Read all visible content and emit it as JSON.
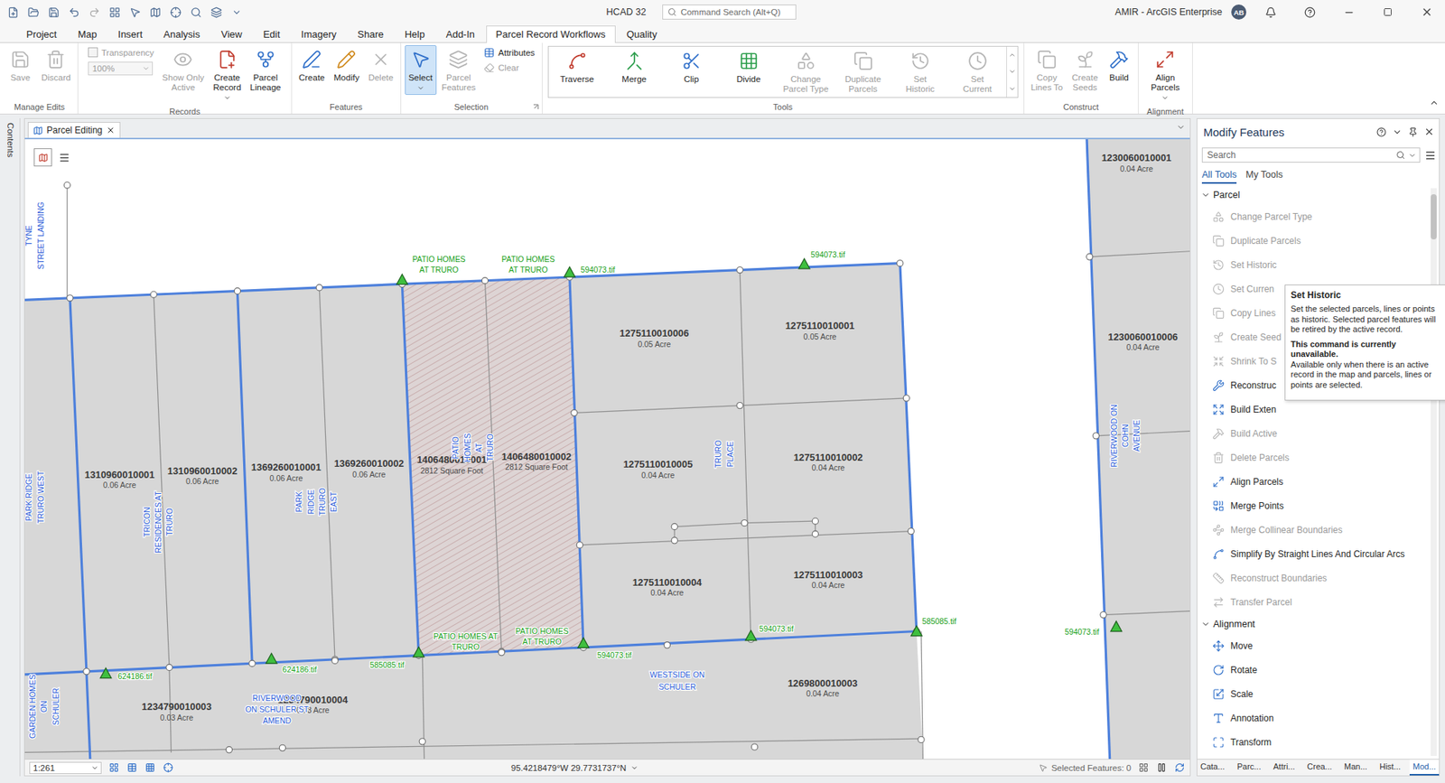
{
  "window": {
    "title": "HCAD 32",
    "account": "AMIR - ArcGIS Enterprise",
    "avatar": "AB"
  },
  "command_search": {
    "placeholder": "Command Search (Alt+Q)"
  },
  "ribbon_tabs": [
    {
      "label": "Project",
      "selected": false
    },
    {
      "label": "Map",
      "selected": false
    },
    {
      "label": "Insert",
      "selected": false
    },
    {
      "label": "Analysis",
      "selected": false
    },
    {
      "label": "View",
      "selected": false
    },
    {
      "label": "Edit",
      "selected": false
    },
    {
      "label": "Imagery",
      "selected": false
    },
    {
      "label": "Share",
      "selected": false
    },
    {
      "label": "Help",
      "selected": false
    },
    {
      "label": "Add-In",
      "selected": false
    },
    {
      "label": "Parcel Record Workflows",
      "selected": true
    },
    {
      "label": "Quality",
      "selected": false
    }
  ],
  "ribbon_groups": [
    {
      "label": "Manage Edits",
      "kind": "plain",
      "launcher": false,
      "items": [
        {
          "label": "Save",
          "kind": "large",
          "disabled": true,
          "selected": false,
          "dropdown": false
        },
        {
          "label": "Discard",
          "kind": "large",
          "disabled": true,
          "selected": false,
          "dropdown": false
        }
      ]
    },
    {
      "label": "Records",
      "kind": "plain",
      "launcher": false,
      "items": [
        {
          "label": "Transparency",
          "kind": "check",
          "disabled": true,
          "checked": false
        },
        {
          "label": "100%",
          "kind": "combo",
          "disabled": true
        },
        {
          "label": "Show Only\nActive",
          "kind": "large",
          "disabled": true,
          "selected": false,
          "dropdown": false
        },
        {
          "label": "Create\nRecord",
          "kind": "large",
          "disabled": false,
          "selected": false,
          "dropdown": true
        },
        {
          "label": "Parcel\nLineage",
          "kind": "large",
          "disabled": false,
          "selected": false,
          "dropdown": false
        }
      ]
    },
    {
      "label": "Features",
      "kind": "plain",
      "launcher": false,
      "items": [
        {
          "label": "Create",
          "kind": "large",
          "disabled": false,
          "selected": false,
          "dropdown": false
        },
        {
          "label": "Modify",
          "kind": "large",
          "disabled": false,
          "selected": false,
          "dropdown": false
        },
        {
          "label": "Delete",
          "kind": "large",
          "disabled": true,
          "selected": false,
          "dropdown": false
        }
      ]
    },
    {
      "label": "Selection",
      "kind": "plain",
      "launcher": true,
      "items": [
        {
          "label": "Select",
          "kind": "large",
          "disabled": false,
          "selected": true,
          "dropdown": true
        },
        {
          "label": "Parcel\nFeatures",
          "kind": "large",
          "disabled": true,
          "selected": false,
          "dropdown": false
        },
        {
          "label": "Attributes",
          "kind": "small",
          "disabled": false
        },
        {
          "label": "Clear",
          "kind": "small",
          "disabled": true
        }
      ]
    },
    {
      "label": "Tools",
      "kind": "gallery",
      "launcher": false,
      "items": [
        {
          "label": "Traverse",
          "kind": "large",
          "disabled": false,
          "selected": false,
          "dropdown": false
        },
        {
          "label": "Merge",
          "kind": "large",
          "disabled": false,
          "selected": false,
          "dropdown": false
        },
        {
          "label": "Clip",
          "kind": "large",
          "disabled": false,
          "selected": false,
          "dropdown": false
        },
        {
          "label": "Divide",
          "kind": "large",
          "disabled": false,
          "selected": false,
          "dropdown": false
        },
        {
          "label": "Change\nParcel Type",
          "kind": "large",
          "disabled": true,
          "selected": false,
          "dropdown": false
        },
        {
          "label": "Duplicate\nParcels",
          "kind": "large",
          "disabled": true,
          "selected": false,
          "dropdown": false
        },
        {
          "label": "Set\nHistoric",
          "kind": "large",
          "disabled": true,
          "selected": false,
          "dropdown": false
        },
        {
          "label": "Set\nCurrent",
          "kind": "large",
          "disabled": true,
          "selected": false,
          "dropdown": false
        }
      ]
    },
    {
      "label": "Construct",
      "kind": "plain",
      "launcher": false,
      "items": [
        {
          "label": "Copy\nLines To",
          "kind": "large",
          "disabled": true,
          "selected": false,
          "dropdown": false
        },
        {
          "label": "Create\nSeeds",
          "kind": "large",
          "disabled": true,
          "selected": false,
          "dropdown": false
        },
        {
          "label": "Build",
          "kind": "large",
          "disabled": false,
          "selected": false,
          "dropdown": false
        }
      ]
    },
    {
      "label": "Alignment",
      "kind": "plain",
      "launcher": false,
      "items": [
        {
          "label": "Align\nParcels",
          "kind": "large",
          "disabled": false,
          "selected": false,
          "dropdown": true
        }
      ]
    }
  ],
  "contents_pane": {
    "label": "Contents"
  },
  "map_view": {
    "tab": "Parcel Editing",
    "scale": "1:261",
    "coordinates": "95.4218479°W 29.7731737°N",
    "selected_features": "Selected Features: 0"
  },
  "map": {
    "parcels": [
      {
        "id": "1310960010001",
        "area": "0.06 Acre",
        "highlighted": false
      },
      {
        "id": "1310960010002",
        "area": "0.06 Acre",
        "highlighted": false
      },
      {
        "id": "1369260010001",
        "area": "0.06 Acre",
        "highlighted": false
      },
      {
        "id": "1369260010002",
        "area": "0.06 Acre",
        "highlighted": false
      },
      {
        "id": "1406480010001",
        "area": "2812 Square Foot",
        "highlighted": true
      },
      {
        "id": "1406480010002",
        "area": "2812 Square Foot",
        "highlighted": true
      },
      {
        "id": "1275110010006",
        "area": "0.05 Acre",
        "highlighted": false
      },
      {
        "id": "1275110010001",
        "area": "0.05 Acre",
        "highlighted": false
      },
      {
        "id": "1275110010005",
        "area": "0.04 Acre",
        "highlighted": false
      },
      {
        "id": "1275110010002",
        "area": "0.04 Acre",
        "highlighted": false
      },
      {
        "id": "1275110010004",
        "area": "0.04 Acre",
        "highlighted": false
      },
      {
        "id": "1275110010003",
        "area": "0.04 Acre",
        "highlighted": false
      },
      {
        "id": "1230060010001",
        "area": "0.04 Acre",
        "highlighted": false
      },
      {
        "id": "1230060010006",
        "area": "0.04 Acre",
        "highlighted": false
      },
      {
        "id": "1234790010003",
        "area": "0.03 Acre",
        "highlighted": false
      },
      {
        "id": "1234790010004",
        "area": "0.03 Acre",
        "highlighted": false
      },
      {
        "id": "1269800010003",
        "area": "0.04 Acre",
        "highlighted": false
      }
    ],
    "subdivisions": [
      {
        "lines": [
          "TYNE",
          "STREET LANDING"
        ],
        "kind": "vertical"
      },
      {
        "lines": [
          "PARK RIDGE",
          "TRURO WEST"
        ],
        "kind": "vertical"
      },
      {
        "lines": [
          "TRICON",
          "RESIDENCES AT",
          "TRURO"
        ],
        "kind": "vertical"
      },
      {
        "lines": [
          "PARK",
          "RIDGE",
          "TRURO",
          "EAST"
        ],
        "kind": "vertical"
      },
      {
        "lines": [
          "PATIO",
          "HOMES",
          "AT",
          "TRURO"
        ],
        "kind": "vertical"
      },
      {
        "lines": [
          "TRURO",
          "PLACE"
        ],
        "kind": "vertical"
      },
      {
        "lines": [
          "RIVERWOOD ON",
          "COHN",
          "AVENUE"
        ],
        "kind": "vertical"
      },
      {
        "lines": [
          "GARDEN HOMES",
          "ON",
          "SCHULER"
        ],
        "kind": "vertical"
      },
      {
        "lines": [
          "RIVERWOOD",
          "ON SCHULER ST",
          "AMEND"
        ],
        "kind": "horizontal"
      },
      {
        "lines": [
          "WESTSIDE ON",
          "SCHULER"
        ],
        "kind": "horizontal"
      }
    ],
    "annotations": [
      {
        "lines": [
          "PATIO HOMES",
          "AT TRURO"
        ]
      },
      {
        "lines": [
          "PATIO HOMES",
          "AT TRURO"
        ]
      },
      {
        "lines": [
          "594073.tif"
        ]
      },
      {
        "lines": [
          "594073.tif"
        ]
      },
      {
        "lines": [
          "PATIO HOMES AT",
          "TRURO"
        ]
      },
      {
        "lines": [
          "PATIO HOMES",
          "AT TRURO"
        ]
      },
      {
        "lines": [
          "594073.tif"
        ]
      },
      {
        "lines": [
          "594073.tif"
        ]
      },
      {
        "lines": [
          "585085.tif"
        ]
      },
      {
        "lines": [
          "594073.tif"
        ]
      },
      {
        "lines": [
          "585085.tif"
        ]
      },
      {
        "lines": [
          "624186.tif"
        ]
      },
      {
        "lines": [
          "624186.tif"
        ]
      }
    ]
  },
  "pane": {
    "title": "Modify Features",
    "search_placeholder": "Search",
    "tabs": [
      {
        "label": "All Tools",
        "selected": true
      },
      {
        "label": "My Tools",
        "selected": false
      }
    ],
    "groups": [
      {
        "label": "Parcel",
        "expanded": true,
        "items": [
          {
            "label": "Change Parcel Type",
            "disabled": true
          },
          {
            "label": "Duplicate Parcels",
            "disabled": true
          },
          {
            "label": "Set Historic",
            "disabled": true
          },
          {
            "label": "Set Curren",
            "disabled": true
          },
          {
            "label": "Copy Lines",
            "disabled": true
          },
          {
            "label": "Create Seed",
            "disabled": true
          },
          {
            "label": "Shrink To S",
            "disabled": true
          },
          {
            "label": "Reconstruc",
            "disabled": false
          },
          {
            "label": "Build Exten",
            "disabled": false
          },
          {
            "label": "Build Active",
            "disabled": true
          },
          {
            "label": "Delete Parcels",
            "disabled": true
          },
          {
            "label": "Align Parcels",
            "disabled": false
          },
          {
            "label": "Merge Points",
            "disabled": false
          },
          {
            "label": "Merge Collinear Boundaries",
            "disabled": true
          },
          {
            "label": "Simplify By Straight Lines And Circular Arcs",
            "disabled": false
          },
          {
            "label": "Reconstruct Boundaries",
            "disabled": true
          },
          {
            "label": "Transfer Parcel",
            "disabled": true
          }
        ]
      },
      {
        "label": "Alignment",
        "expanded": true,
        "items": [
          {
            "label": "Move",
            "disabled": false
          },
          {
            "label": "Rotate",
            "disabled": false
          },
          {
            "label": "Scale",
            "disabled": false
          },
          {
            "label": "Annotation",
            "disabled": false
          },
          {
            "label": "Transform",
            "disabled": false
          }
        ]
      }
    ],
    "bottom_tabs": [
      {
        "label": "Cata...",
        "selected": false
      },
      {
        "label": "Parc...",
        "selected": false
      },
      {
        "label": "Attri...",
        "selected": false
      },
      {
        "label": "Crea...",
        "selected": false
      },
      {
        "label": "Man...",
        "selected": false
      },
      {
        "label": "Hist...",
        "selected": false
      },
      {
        "label": "Mod...",
        "selected": true
      }
    ]
  },
  "tooltip": {
    "title": "Set Historic",
    "description": "Set the selected parcels, lines or points as historic. Selected parcel features will be retired by the active record.",
    "notice": "This command is currently unavailable.",
    "detail": "Available only when there is an active record in the map and parcels, lines or points are selected."
  }
}
